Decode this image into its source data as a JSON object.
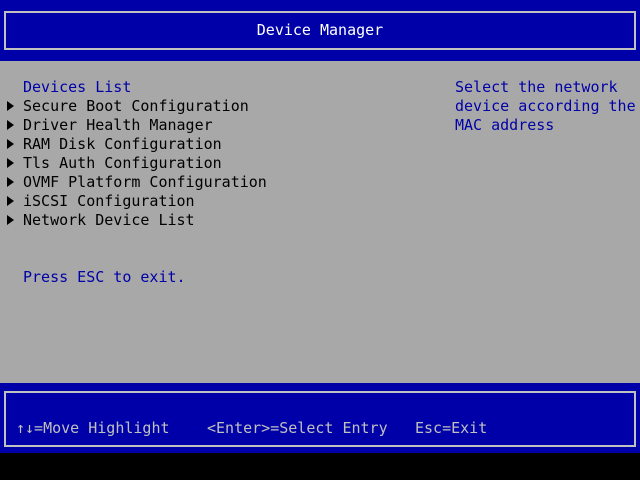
{
  "title": "Device Manager",
  "main": {
    "section_header": "Devices List",
    "items": [
      {
        "label": "Secure Boot Configuration"
      },
      {
        "label": "Driver Health Manager"
      },
      {
        "label": "RAM Disk Configuration"
      },
      {
        "label": "Tls Auth Configuration"
      },
      {
        "label": "OVMF Platform Configuration"
      },
      {
        "label": "iSCSI Configuration"
      },
      {
        "label": "Network Device List"
      }
    ],
    "exit_hint": "Press ESC to exit."
  },
  "help": {
    "lines": [
      "Select the network",
      "device according the",
      "MAC address"
    ]
  },
  "status": {
    "move": "↑↓=Move Highlight",
    "select": "<Enter>=Select Entry",
    "exit": "Esc=Exit"
  },
  "colors": {
    "bar_blue": "#0000a8",
    "panel_gray": "#a8a8a8",
    "text_white": "#ffffff",
    "text_light_gray": "#c0c0c0"
  }
}
